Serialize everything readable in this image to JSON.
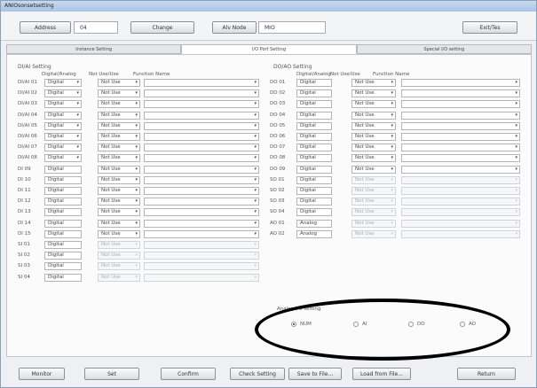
{
  "window": {
    "title": "ANIOsonsetsetting"
  },
  "toolbar": {
    "address_label": "Address",
    "address_value": "04",
    "change_label": "Change",
    "alv_label": "Alv Node",
    "alv_value": "MIO",
    "exit_label": "Exit/Tes"
  },
  "tabs": [
    "Instance Setting",
    "I/O Port Setting",
    "Special I/O setting"
  ],
  "left": {
    "title": "DI/AI Setting",
    "hdr_da": "Digital/Analog",
    "hdr_use": "Not Use/Use",
    "hdr_fn": "Function Name",
    "rows": [
      {
        "label": "DI/AI 01",
        "da": "Digital",
        "use": "Not Use",
        "fn": ""
      },
      {
        "label": "DI/AI 02",
        "da": "Digital",
        "use": "Not Use",
        "fn": ""
      },
      {
        "label": "DI/AI 03",
        "da": "Digital",
        "use": "Not Use",
        "fn": ""
      },
      {
        "label": "DI/AI 04",
        "da": "Digital",
        "use": "Not Use",
        "fn": ""
      },
      {
        "label": "DI/AI 05",
        "da": "Digital",
        "use": "Not Use",
        "fn": ""
      },
      {
        "label": "DI/AI 06",
        "da": "Digital",
        "use": "Not Use",
        "fn": ""
      },
      {
        "label": "DI/AI 07",
        "da": "Digital",
        "use": "Not Use",
        "fn": ""
      },
      {
        "label": "DI/AI 08",
        "da": "Digital",
        "use": "Not Use",
        "fn": ""
      },
      {
        "label": "DI 09",
        "da": "Digital",
        "use": "Not Use",
        "fn": ""
      },
      {
        "label": "DI 10",
        "da": "Digital",
        "use": "Not Use",
        "fn": ""
      },
      {
        "label": "DI 11",
        "da": "Digital",
        "use": "Not Use",
        "fn": ""
      },
      {
        "label": "DI 12",
        "da": "Digital",
        "use": "Not Use",
        "fn": ""
      },
      {
        "label": "DI 13",
        "da": "Digital",
        "use": "Not Use",
        "fn": ""
      },
      {
        "label": "DI 14",
        "da": "Digital",
        "use": "Not Use",
        "fn": ""
      },
      {
        "label": "DI 15",
        "da": "Digital",
        "use": "Not Use",
        "fn": ""
      },
      {
        "label": "SI 01",
        "da": "Digital",
        "use": "Not Use",
        "fn": ""
      },
      {
        "label": "SI 02",
        "da": "Digital",
        "use": "Not Use",
        "fn": ""
      },
      {
        "label": "SI 03",
        "da": "Digital",
        "use": "Not Use",
        "fn": ""
      },
      {
        "label": "SI 04",
        "da": "Digital",
        "use": "Not Use",
        "fn": ""
      }
    ]
  },
  "right": {
    "title": "DO/AO Setting",
    "hdr_da": "Digital/Analog",
    "hdr_use": "Not Use/Use",
    "hdr_fn": "Function Name",
    "rows": [
      {
        "label": "DO 01",
        "da": "Digital",
        "use": "Not Use",
        "fn": ""
      },
      {
        "label": "DO 02",
        "da": "Digital",
        "use": "Not Use",
        "fn": ""
      },
      {
        "label": "DO 03",
        "da": "Digital",
        "use": "Not Use",
        "fn": ""
      },
      {
        "label": "DO 04",
        "da": "Digital",
        "use": "Not Use",
        "fn": ""
      },
      {
        "label": "DO 05",
        "da": "Digital",
        "use": "Not Use",
        "fn": ""
      },
      {
        "label": "DO 06",
        "da": "Digital",
        "use": "Not Use",
        "fn": ""
      },
      {
        "label": "DO 07",
        "da": "Digital",
        "use": "Not Use",
        "fn": ""
      },
      {
        "label": "DO 08",
        "da": "Digital",
        "use": "Not Use",
        "fn": ""
      },
      {
        "label": "DO 09",
        "da": "Digital",
        "use": "Not Use",
        "fn": ""
      },
      {
        "label": "SO 01",
        "da": "Digital",
        "use": "Not Use",
        "fn": ""
      },
      {
        "label": "SO 02",
        "da": "Digital",
        "use": "Not Use",
        "fn": ""
      },
      {
        "label": "SO 03",
        "da": "Digital",
        "use": "Not Use",
        "fn": ""
      },
      {
        "label": "SO 04",
        "da": "Digital",
        "use": "Not Use",
        "fn": ""
      },
      {
        "label": "AO 01",
        "da": "Analog",
        "use": "Not Use",
        "fn": ""
      },
      {
        "label": "AO 02",
        "da": "Analog",
        "use": "Not Use",
        "fn": ""
      }
    ],
    "analog_title": "Analog I/O setting",
    "radios": [
      {
        "label": "NUM",
        "selected": true
      },
      {
        "label": "AI",
        "selected": false
      },
      {
        "label": "DO",
        "selected": false
      },
      {
        "label": "AO",
        "selected": false
      }
    ]
  },
  "footer": {
    "buttons": [
      "Monitor",
      "Set",
      "Confirm",
      "Check Setting",
      "Save to File...",
      "Load from File...",
      "Return"
    ]
  }
}
